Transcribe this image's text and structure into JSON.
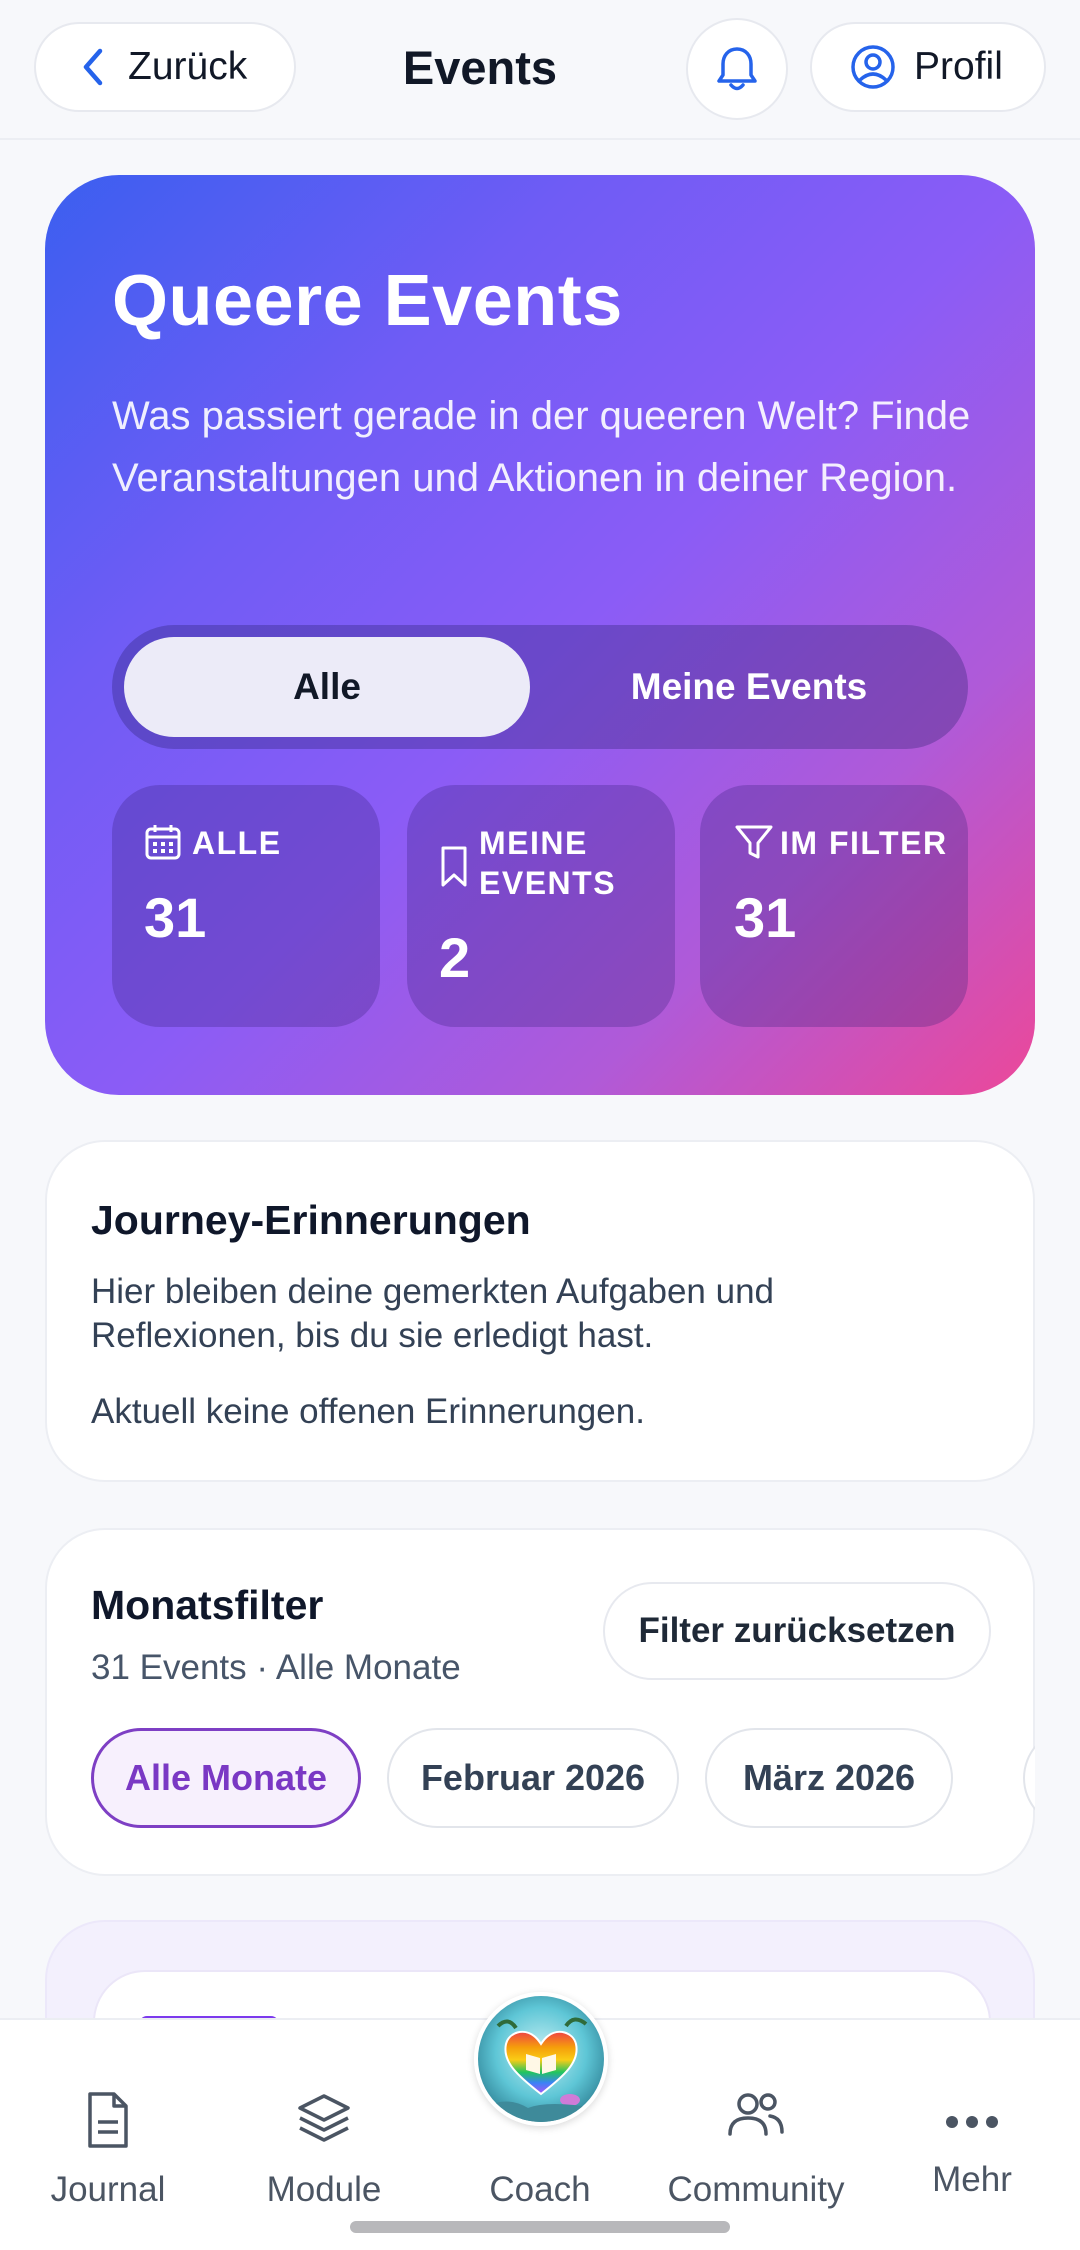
{
  "header": {
    "back_label": "Zurück",
    "title": "Events",
    "profile_label": "Profil"
  },
  "hero": {
    "title": "Queere Events",
    "description": "Was passiert gerade in der queeren Welt? Finde Veranstaltungen und Aktionen in deiner Region.",
    "tabs": [
      {
        "label": "Alle",
        "active": true
      },
      {
        "label": "Meine Events",
        "active": false
      }
    ],
    "stats": [
      {
        "icon": "calendar-icon",
        "label": "ALLE",
        "value": "31"
      },
      {
        "icon": "bookmark-icon",
        "label": "MEINE EVENTS",
        "value": "2"
      },
      {
        "icon": "filter-icon",
        "label": "IM FILTER",
        "value": "31"
      }
    ]
  },
  "journey": {
    "title": "Journey-Erinnerungen",
    "description": "Hier bleiben deine gemerkten Aufgaben und Reflexionen, bis du sie erledigt hast.",
    "empty_text": "Aktuell keine offenen Erinnerungen."
  },
  "month_filter": {
    "title": "Monatsfilter",
    "subtitle": "31 Events · Alle Monate",
    "reset_label": "Filter zurücksetzen",
    "chips": [
      {
        "label": "Alle Monate",
        "active": true
      },
      {
        "label": "Februar 2026",
        "active": false
      },
      {
        "label": "März 2026",
        "active": false
      }
    ]
  },
  "bottom_nav": {
    "items": [
      {
        "label": "Journal",
        "icon": "document-icon"
      },
      {
        "label": "Module",
        "icon": "layers-icon"
      },
      {
        "label": "Coach",
        "icon": "coach-avatar"
      },
      {
        "label": "Community",
        "icon": "users-icon"
      },
      {
        "label": "Mehr",
        "icon": "more-icon"
      }
    ]
  },
  "colors": {
    "hero_gradient_start": "#3b5ff0",
    "hero_gradient_mid": "#8b5cf6",
    "hero_gradient_end": "#ec4899",
    "accent_purple": "#7a38c4"
  }
}
